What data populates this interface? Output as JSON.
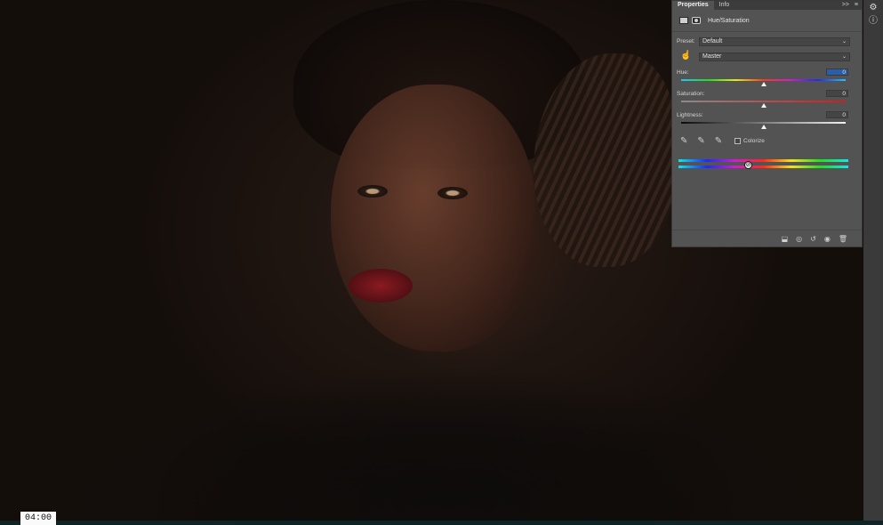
{
  "panel": {
    "tabs": [
      "Properties",
      "Info"
    ],
    "tab_controls": [
      ">>",
      "≡"
    ],
    "adjustment_title": "Hue/Saturation",
    "preset_label": "Preset:",
    "preset_value": "Default",
    "channel_value": "Master",
    "hue": {
      "label": "Hue:",
      "value": "0",
      "position": 0.5
    },
    "saturation": {
      "label": "Saturation:",
      "value": "0",
      "position": 0.5
    },
    "lightness": {
      "label": "Lightness:",
      "value": "0",
      "position": 0.5
    },
    "colorize_label": "Colorize",
    "colorize_checked": false
  },
  "timestamp": "04:00",
  "colors": {
    "panel_bg": "#535353",
    "accent_field": "#2b5ea8"
  },
  "icons": {
    "right_toolbar": [
      "properties-icon",
      "info-icon"
    ],
    "bottom": [
      "clip-to-layer-icon",
      "view-previous-icon",
      "reset-icon",
      "visibility-eye-icon",
      "delete-icon"
    ],
    "tools": [
      "eyedropper-icon",
      "eyedropper-plus-icon",
      "eyedropper-minus-icon"
    ]
  }
}
